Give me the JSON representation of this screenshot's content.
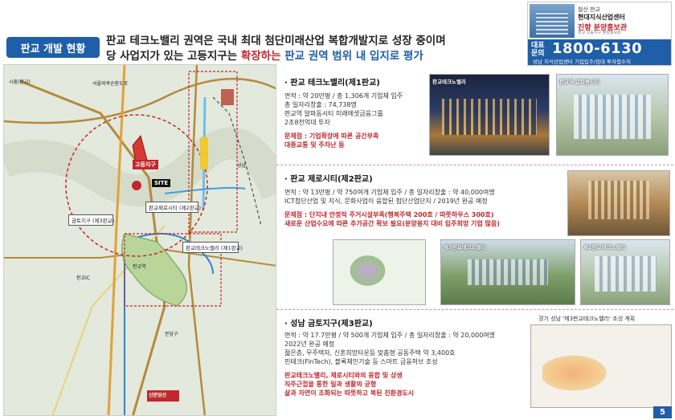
{
  "header": {
    "title_pill": "판교 개발 현황",
    "headline_line1": "판교 테크노밸리 권역은 국내 최대 첨단미래산업 복합개발지로 성장 중이며",
    "headline_line2_a": "당 사업지가 있는 고등지구는 ",
    "headline_line2_b": "확장하는",
    "headline_line2_c": " 판교 권역 범위 내 입지로 평가"
  },
  "brand": {
    "line1": "철산 판교",
    "line2": "현대지식산업센터",
    "logo": "진향 분양홍보관",
    "logo_sub": "판교 고등지구 분양홍보관",
    "phone_label": "대표 문의",
    "phone": "1800-6130",
    "phone_sub": "성남 지식산업센터 기업입주/임대 투자접수처"
  },
  "map": {
    "labels": [
      "시흥(판교)",
      "서울외곽순환도로",
      "판교IC",
      "성남",
      "금토지구 (제3판교)",
      "판교제로시티 (제2판교)",
      "판교테크노밸리 (제1판교)",
      "고등지구",
      "SITE",
      "신분당선",
      "판교역",
      "분당구"
    ]
  },
  "sections": [
    {
      "title": "· 판교 테크노밸리(제1판교)",
      "lines": [
        "면적 : 약 20만평 / 총 1,306개 기업체 입주",
        "총 일자리창출 : 74,738명",
        "판교역 알파돔시티 미래에셋금융그룹",
        "2조8천억대 투자"
      ],
      "issue_lines": [
        "문제점 : 기업확장에 따른 공간부족",
        "대중교통 및 주차난 등"
      ],
      "photo_caps": [
        "판교테크노밸리",
        "판교역 알파돔시티"
      ]
    },
    {
      "title": "· 판교 제로시티(제2판교)",
      "lines": [
        "면적 : 약 13만평 / 약 750여개 기업체 입주 / 총 일자리창출 : 약 40,000여명",
        "ICT첨단산업 및 지식, 문화사업이 융합된 첨단산업단지 / 2019년 완공 예정"
      ],
      "issue_lines": [
        "문제점 : 단지내 안정적 주거시설부족(행복주택 200호 / 따뜻하우스 300호)",
        "새로운 산업수요에 따른 추가공간 확보 필요(분양용지 대비 입주희망 기업 많음)"
      ],
      "photo_caps": [
        "제3판교테크노밸리",
        "제2판교테크노밸리"
      ]
    },
    {
      "title": "· 성남 금토지구(제3판교)",
      "lines": [
        "면적 : 약 17.7만평 / 약 500개 기업체 입주 / 총 일자리창출 : 약 20,000여명",
        "2022년 완공 예정",
        "젊은층, 무주택자, 신혼희망타운등 맞춤형 공동주택 약 3,400호",
        "핀테크(FinTech), 블록체인기술 등 스마트 금융허브 조성"
      ],
      "issue_lines": [
        "판교테크노밸리, 제로시티와의 융합 및 상생",
        "직주근접을 통한 일과 생활의 균형",
        "삶과 자연이 조화되는 따뜻하고 복된 친환경도시"
      ],
      "plan_title": "경기 성남 '제3판교테크노밸리' 조성 계획"
    }
  ],
  "page_number": "5",
  "colors": {
    "accent": "#1f5ea8",
    "red": "#c1272d"
  }
}
